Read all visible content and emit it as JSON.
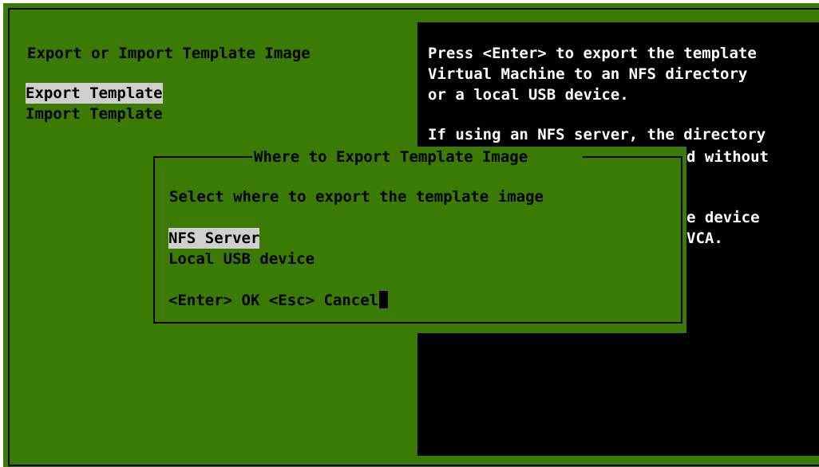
{
  "main": {
    "title": "Export or Import Template Image",
    "menu": [
      {
        "label": "Export Template",
        "selected": true
      },
      {
        "label": "Import Template",
        "selected": false
      }
    ]
  },
  "help": {
    "lines": [
      "Press <Enter> to export the template",
      "Virtual Machine to an NFS directory",
      "or a local USB device.",
      "",
      "If using an NFS server, the directory",
      "d without",
      "",
      "e device",
      "VCA."
    ]
  },
  "dialog": {
    "title": "Where to Export Template Image",
    "prompt": "Select where to export the template image",
    "options": [
      {
        "label": "NFS Server",
        "selected": true
      },
      {
        "label": "Local USB device",
        "selected": false
      }
    ],
    "footer": "<Enter> OK <Esc> Cancel"
  },
  "colors": {
    "background": "#3c7a06",
    "help_background": "#000000",
    "highlight": "#cfcfcf"
  }
}
